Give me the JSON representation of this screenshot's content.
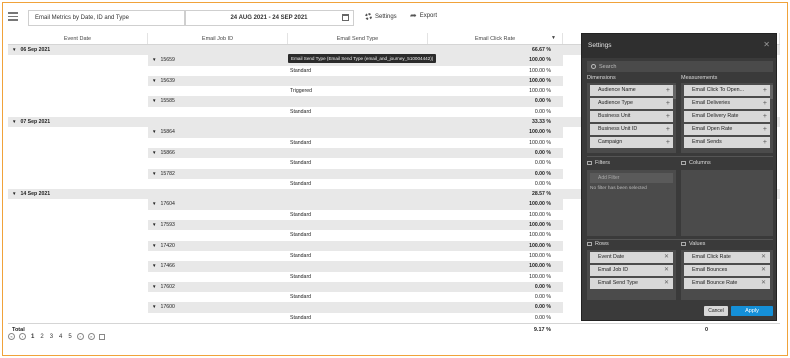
{
  "toolbar": {
    "report_title": "Email Metrics by Date, ID and Type",
    "date_range": "24 AUG 2021 - 24 SEP 2021",
    "settings_label": "Settings",
    "export_label": "Export"
  },
  "table": {
    "headers": [
      "Event Date",
      "Email Job ID",
      "Email Send Type",
      "Email Click Rate"
    ],
    "sort_indicator": "▼",
    "tooltip": "Email Send Type (Email Send Type (email_and_journey_510004442))",
    "rows": [
      {
        "kind": "date",
        "label": "06 Sep 2021",
        "value": "66.67 %"
      },
      {
        "kind": "job",
        "label": "15659",
        "value": "100.00 %"
      },
      {
        "kind": "type",
        "label": "Standard",
        "value": "100.00 %"
      },
      {
        "kind": "job",
        "label": "15639",
        "value": "100.00 %"
      },
      {
        "kind": "type",
        "label": "Triggered",
        "value": "100.00 %"
      },
      {
        "kind": "job",
        "label": "15585",
        "value": "0.00 %"
      },
      {
        "kind": "type",
        "label": "Standard",
        "value": "0.00 %"
      },
      {
        "kind": "date",
        "label": "07 Sep 2021",
        "value": "33.33 %"
      },
      {
        "kind": "job",
        "label": "15864",
        "value": "100.00 %"
      },
      {
        "kind": "type",
        "label": "Standard",
        "value": "100.00 %"
      },
      {
        "kind": "job",
        "label": "15866",
        "value": "0.00 %"
      },
      {
        "kind": "type",
        "label": "Standard",
        "value": "0.00 %"
      },
      {
        "kind": "job",
        "label": "15782",
        "value": "0.00 %"
      },
      {
        "kind": "type",
        "label": "Standard",
        "value": "0.00 %"
      },
      {
        "kind": "date",
        "label": "14 Sep 2021",
        "value": "28.57 %"
      },
      {
        "kind": "job",
        "label": "17604",
        "value": "100.00 %"
      },
      {
        "kind": "type",
        "label": "Standard",
        "value": "100.00 %"
      },
      {
        "kind": "job",
        "label": "17593",
        "value": "100.00 %"
      },
      {
        "kind": "type",
        "label": "Standard",
        "value": "100.00 %"
      },
      {
        "kind": "job",
        "label": "17420",
        "value": "100.00 %"
      },
      {
        "kind": "type",
        "label": "Standard",
        "value": "100.00 %"
      },
      {
        "kind": "job",
        "label": "17466",
        "value": "100.00 %"
      },
      {
        "kind": "type",
        "label": "Standard",
        "value": "100.00 %"
      },
      {
        "kind": "job",
        "label": "17602",
        "value": "0.00 %"
      },
      {
        "kind": "type",
        "label": "Standard",
        "value": "0.00 %"
      },
      {
        "kind": "job",
        "label": "17600",
        "value": "0.00 %"
      },
      {
        "kind": "type",
        "label": "Standard",
        "value": "0.00 %"
      }
    ],
    "total_label": "Total",
    "total_value": "9.17 %",
    "total_extra": "0"
  },
  "pager": {
    "pages": [
      "1",
      "2",
      "3",
      "4",
      "5"
    ],
    "active_page": "1"
  },
  "settings_panel": {
    "title": "Settings",
    "search_placeholder": "Search",
    "dimensions_label": "Dimensions",
    "measurements_label": "Measurements",
    "dimensions": [
      "Audience Name",
      "Audience Type",
      "Business Unit",
      "Business Unit ID",
      "Campaign"
    ],
    "measurements": [
      "Email Click To Open...",
      "Email Deliveries",
      "Email Delivery Rate",
      "Email Open Rate",
      "Email Sends"
    ],
    "filters_label": "Filters",
    "columns_label": "Columns",
    "add_filter_label": "Add Filter",
    "filter_note": "No filter has been selected",
    "rows_label": "Rows",
    "values_label": "Values",
    "rows": [
      "Event Date",
      "Email Job ID",
      "Email Send Type"
    ],
    "values": [
      "Email Click Rate",
      "Email Bounces",
      "Email Bounce Rate"
    ],
    "cancel_label": "Cancel",
    "apply_label": "Apply"
  }
}
